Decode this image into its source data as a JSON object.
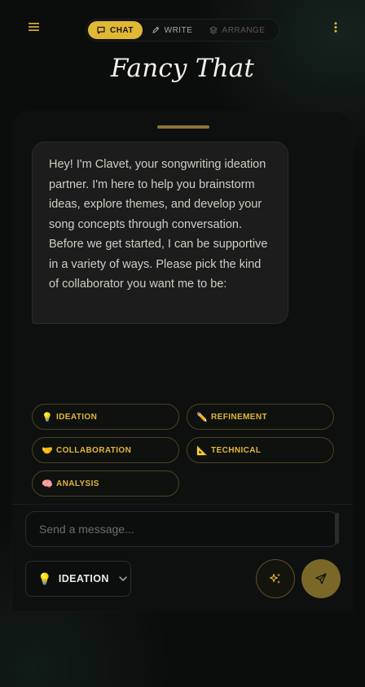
{
  "header": {
    "title": "Fancy That",
    "tabs": [
      {
        "label": "CHAT",
        "icon": "chat-bubble-icon",
        "state": "active"
      },
      {
        "label": "WRITE",
        "icon": "pencil-icon",
        "state": "inactive"
      },
      {
        "label": "ARRANGE",
        "icon": "layers-icon",
        "state": "disabled"
      }
    ]
  },
  "chat": {
    "assistant_message": "Hey! I'm Clavet, your songwriting ideation partner. I'm here to help you brainstorm ideas, explore themes, and develop your song concepts through conversation. Before we get started, I can be supportive in a variety of ways. Please pick the kind of collaborator you want me to be:"
  },
  "modes": [
    {
      "emoji": "💡",
      "label": "IDEATION"
    },
    {
      "emoji": "✏️",
      "label": "REFINEMENT"
    },
    {
      "emoji": "🤝",
      "label": "COLLABORATION"
    },
    {
      "emoji": "📐",
      "label": "TECHNICAL"
    },
    {
      "emoji": "🧠",
      "label": "ANALYSIS"
    }
  ],
  "composer": {
    "placeholder": "Send a message...",
    "selected_mode_emoji": "💡",
    "selected_mode": "IDEATION"
  },
  "colors": {
    "accent": "#e0b836",
    "background": "#0b0d0c",
    "bubble": "#1b1c1b"
  }
}
